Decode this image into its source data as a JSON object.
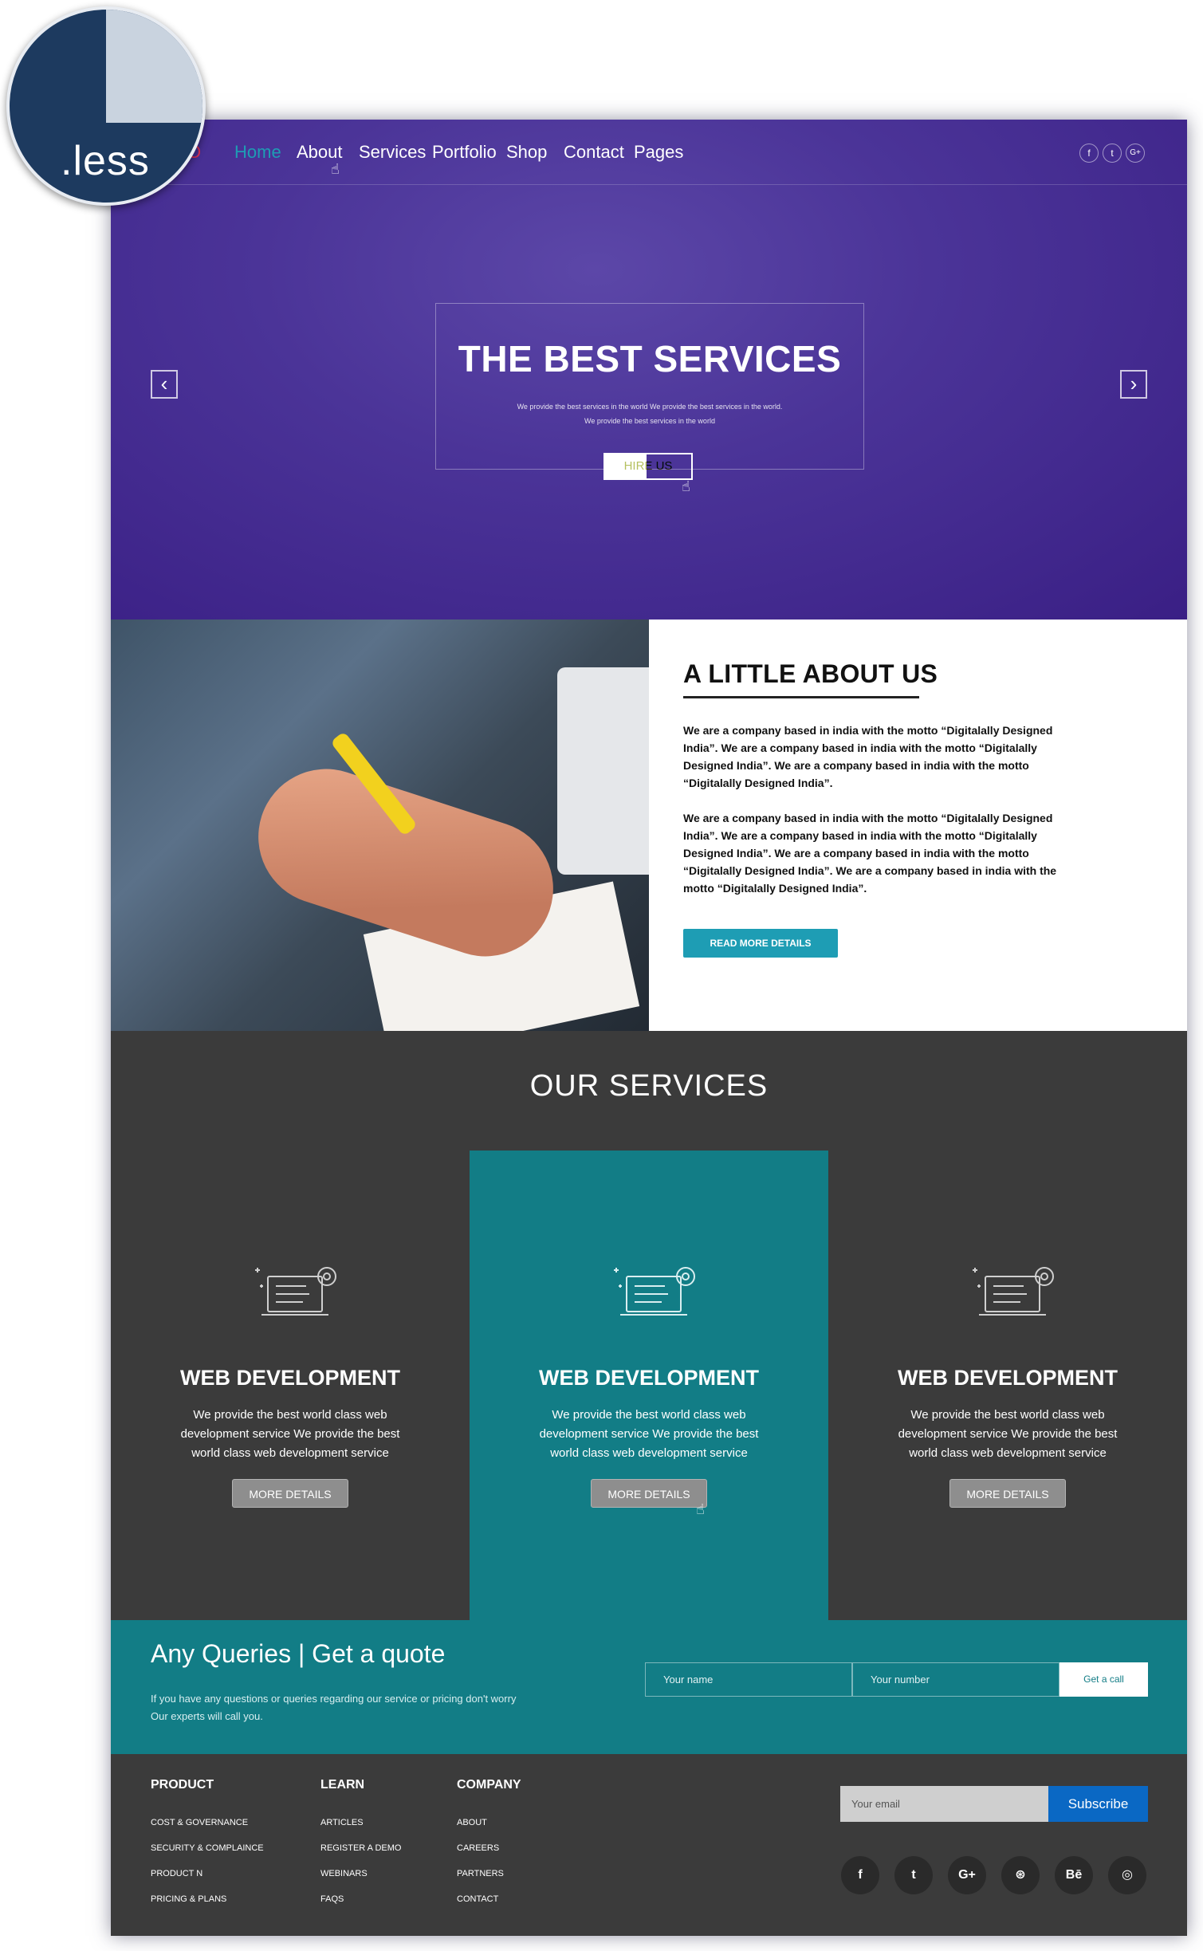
{
  "badge": {
    "text": ".less"
  },
  "nav": {
    "logo_partial": "O",
    "items": [
      {
        "label": "Home",
        "active": true
      },
      {
        "label": "About"
      },
      {
        "label": "Services"
      },
      {
        "label": "Portfolio"
      },
      {
        "label": "Shop"
      },
      {
        "label": "Contact"
      },
      {
        "label": "Pages"
      }
    ],
    "social": [
      {
        "glyph": "f",
        "icon": "facebook-icon"
      },
      {
        "glyph": "t",
        "icon": "twitter-icon"
      },
      {
        "glyph": "G+",
        "icon": "google-plus-icon"
      }
    ]
  },
  "hero": {
    "title": "THE BEST SERVICES",
    "subtitle_line1": "We provide the best services in the world We provide the best services in the world.",
    "subtitle_line2": "We provide the best services in the world",
    "button": "HIRE US",
    "prev": "‹",
    "next": "›"
  },
  "about": {
    "title": "A LITTLE ABOUT US",
    "p1": "We are a company based in india with the motto “Digitalally Designed India”. We are a company based in india with the motto “Digitalally Designed India”. We are a company based in india with the motto “Digitalally Designed India”.",
    "p2": "We are a company based in india with the motto “Digitalally Designed India”. We are a company based in india with the motto “Digitalally Designed India”. We are a company based in india with the motto “Digitalally Designed India”. We are a company based in india with the motto “Digitalally Designed India”.",
    "button": "READ MORE DETAILS"
  },
  "services": {
    "title": "OUR SERVICES",
    "items": [
      {
        "title": "WEB DEVELOPMENT",
        "desc": "We provide the best world class web development service We provide the best world class web development service",
        "button": "MORE DETAILS"
      },
      {
        "title": "WEB DEVELOPMENT",
        "desc": "We provide the best world class web development service We provide the best world class web development service",
        "button": "MORE DETAILS"
      },
      {
        "title": "WEB DEVELOPMENT",
        "desc": "We provide the best world class web development service We provide the best world class web development service",
        "button": "MORE DETAILS"
      }
    ]
  },
  "query": {
    "title": "Any Queries | Get a quote",
    "sub": "If you have any questions or queries regarding our service or pricing don't worry Our experts will call you.",
    "name_placeholder": "Your name",
    "number_placeholder": "Your number",
    "button": "Get a call"
  },
  "footer": {
    "columns": [
      {
        "head": "PRODUCT",
        "links": [
          "COST & GOVERNANCE",
          "SECURITY & COMPLAINCE",
          "PRODUCT N",
          "PRICING & PLANS"
        ]
      },
      {
        "head": "LEARN",
        "links": [
          "ARTICLES",
          "REGISTER A DEMO",
          "WEBINARS",
          "FAQS"
        ]
      },
      {
        "head": "COMPANY",
        "links": [
          "ABOUT",
          "CAREERS",
          "PARTNERS",
          "CONTACT"
        ]
      }
    ],
    "email_placeholder": "Your email",
    "subscribe": "Subscribe",
    "social": [
      {
        "glyph": "f",
        "icon": "facebook-icon"
      },
      {
        "glyph": "t",
        "icon": "twitter-icon"
      },
      {
        "glyph": "G+",
        "icon": "google-plus-icon"
      },
      {
        "glyph": "⊛",
        "icon": "dribbble-icon"
      },
      {
        "glyph": "Bē",
        "icon": "behance-icon"
      },
      {
        "glyph": "◎",
        "icon": "instagram-icon"
      }
    ]
  },
  "colors": {
    "hero": "#4b3498",
    "accent": "#1e9db4",
    "teal": "#127d86",
    "dark": "#3b3b3b",
    "subscribe": "#0a68c4"
  }
}
